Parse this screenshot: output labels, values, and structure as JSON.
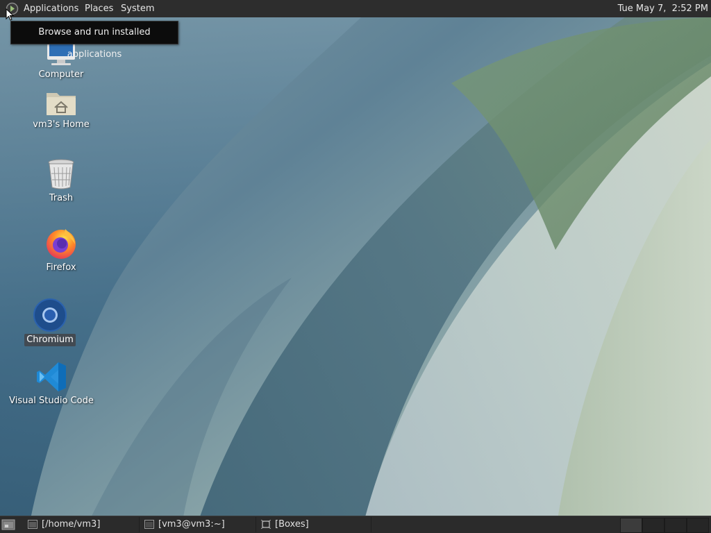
{
  "top_panel": {
    "menus": [
      "Applications",
      "Places",
      "System"
    ],
    "clock": "Tue May 7,  2:52 PM"
  },
  "tooltip": "Browse and run installed applications",
  "desktop_icons": [
    {
      "label": "Computer",
      "icon": "computer-icon"
    },
    {
      "label": "vm3's Home",
      "icon": "home-folder-icon"
    },
    {
      "label": "Trash",
      "icon": "trash-icon"
    },
    {
      "label": "Firefox",
      "icon": "firefox-icon"
    },
    {
      "label": "Chromium",
      "icon": "chromium-icon",
      "selected": true
    },
    {
      "label": "Visual Studio Code",
      "icon": "vscode-icon"
    }
  ],
  "taskbar": {
    "show_desktop_icon": "show-desktop-icon",
    "windows": [
      {
        "label": "[/home/vm3]",
        "icon": "folder-window-icon"
      },
      {
        "label": "[vm3@vm3:~]",
        "icon": "terminal-window-icon"
      },
      {
        "label": "[Boxes]",
        "icon": "boxes-window-icon"
      }
    ],
    "workspaces": 4
  },
  "colors": {
    "panel": "#2d2d2d",
    "panel_text": "#e6e6e6",
    "wallpaper_blue": "#4f7590",
    "wallpaper_green": "#6b8a6a",
    "tooltip_bg": "#0c0c0c"
  }
}
